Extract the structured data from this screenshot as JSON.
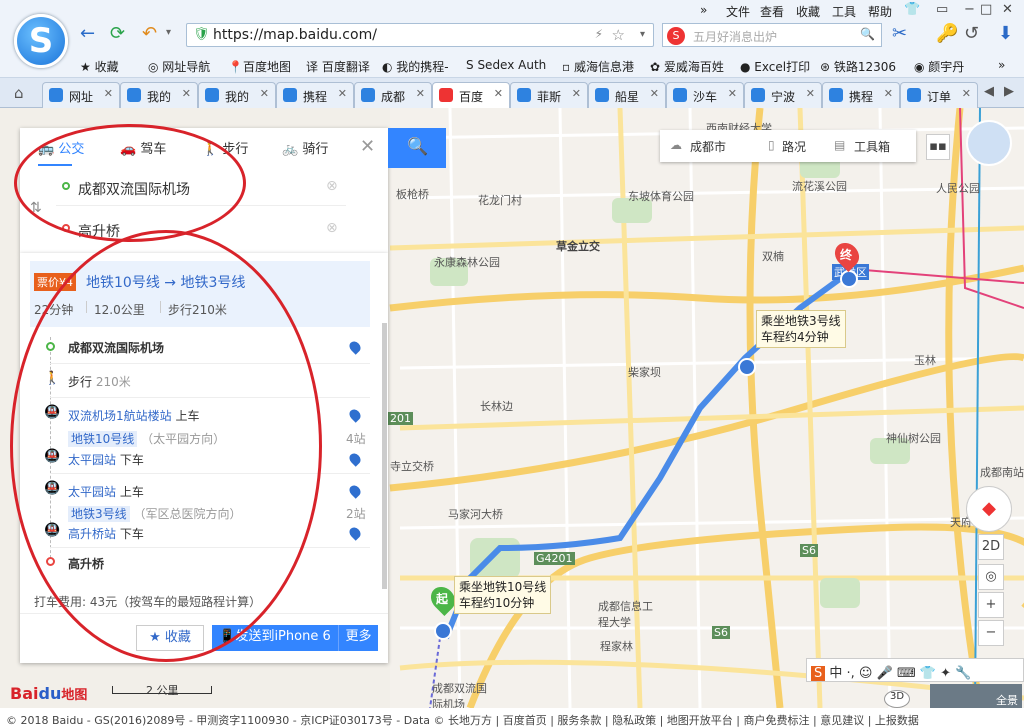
{
  "menubar": {
    "items": [
      "文件",
      "查看",
      "收藏",
      "工具",
      "帮助"
    ]
  },
  "address": {
    "url": "https://map.baidu.com/",
    "search_placeholder": "五月好消息出炉"
  },
  "bookmarks": [
    "收藏",
    "网址导航",
    "百度地图",
    "百度翻译",
    "我的携程-",
    "Sedex Auth",
    "威海信息港",
    "爱威海百姓",
    "Excel打印",
    "铁路12306",
    "颜宇丹"
  ],
  "tabs": [
    "网址",
    "我的",
    "我的",
    "携程",
    "成都",
    "百度",
    "菲斯",
    "船星",
    "沙车",
    "宁波",
    "携程",
    "订单"
  ],
  "route_modes": [
    "公交",
    "驾车",
    "步行",
    "骑行"
  ],
  "origin": "成都双流国际机场",
  "destination": "高升桥",
  "route": {
    "fare_badge": "票价¥4",
    "summary": "地铁10号线 → 地铁3号线",
    "duration": "22分钟",
    "distance": "12.0公里",
    "walk": "步行210米"
  },
  "steps": {
    "start": "成都双流国际机场",
    "walk": "步行",
    "walk_dist": "210米",
    "board1": "双流机场1航站楼站",
    "board1_suffix": "上车",
    "line1": "地铁10号线",
    "line1_dir": "（太平园方向）",
    "line1_stops": "4站",
    "alight1": "太平园站",
    "alight1_suffix": "下车",
    "board2": "太平园站",
    "board2_suffix": "上车",
    "line2": "地铁3号线",
    "line2_dir": "（军区总医院方向）",
    "line2_stops": "2站",
    "alight2": "高升桥站",
    "alight2_suffix": "下车",
    "end": "高升桥"
  },
  "taxi": "打车费用: 43元（按驾车的最短路程计算）",
  "buttons": {
    "favorite": "收藏",
    "send": "发送到iPhone 6",
    "more": "更多"
  },
  "map_tools": {
    "city": "成都市",
    "traffic": "路况",
    "toolbox": "工具箱",
    "view2d": "2D",
    "overview": "全景"
  },
  "bubbles": {
    "metro10": [
      "乘坐地铁10号线",
      "车程约10分钟"
    ],
    "metro3": [
      "乘坐地铁3号线",
      "车程约4分钟"
    ],
    "start": "起",
    "end": "终"
  },
  "map_labels": [
    "西南财经大学",
    "流花溪公园",
    "人民公园",
    "东坡体育公园",
    "花龙门村",
    "板枪桥",
    "草金立交",
    "双楠",
    "永康森林公园",
    "武侯区",
    "柴家坝",
    "玉林",
    "长林边",
    "神仙树公园",
    "寺立交桥",
    "成都南站",
    "马家河大桥",
    "天府",
    "成都信息工程大学",
    "程家林",
    "成都双流国际机场",
    "G4201",
    "S6",
    "S6",
    "201"
  ],
  "scale": "2 公里",
  "footer": "© 2018 Baidu - GS(2016)2089号 - 甲测资字1100930 - 京ICP证030173号 - Data © 长地万方 | 百度首页 | 服务条款 | 隐私政策 | 地图开放平台 | 商户免费标注 | 意见建议 | 上报数据",
  "colors": {
    "accent": "#3385ff",
    "route": "#4a8be8",
    "annotation": "#d8232a"
  }
}
